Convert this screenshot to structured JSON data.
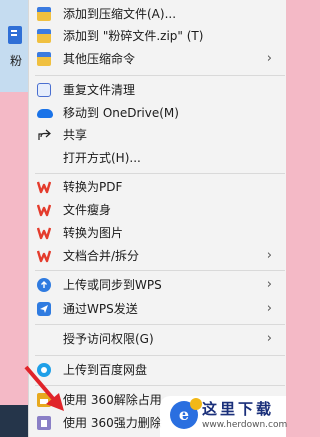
{
  "background": {
    "file_label": "粉"
  },
  "menu": {
    "items": [
      {
        "label": "添加到压缩文件(A)...",
        "icon": "archive-icon"
      },
      {
        "label": "添加到 \"粉碎文件.zip\" (T)",
        "icon": "archive-icon"
      },
      {
        "label": "其他压缩命令",
        "icon": "archive-icon",
        "submenu": true
      },
      {
        "label": "重复文件清理",
        "icon": "duplicate-cleanup-icon"
      },
      {
        "label": "移动到 OneDrive(M)",
        "icon": "onedrive-icon"
      },
      {
        "label": "共享",
        "icon": "share-icon"
      },
      {
        "label": "打开方式(H)...",
        "icon": ""
      },
      {
        "label": "转换为PDF",
        "icon": "wps-icon"
      },
      {
        "label": "文件瘦身",
        "icon": "wps-icon"
      },
      {
        "label": "转换为图片",
        "icon": "wps-icon"
      },
      {
        "label": "文档合并/拆分",
        "icon": "wps-icon",
        "submenu": true
      },
      {
        "label": "上传或同步到WPS",
        "icon": "cloud-upload-icon",
        "submenu": true
      },
      {
        "label": "通过WPS发送",
        "icon": "send-icon",
        "submenu": true
      },
      {
        "label": "授予访问权限(G)",
        "icon": "",
        "submenu": true
      },
      {
        "label": "上传到百度网盘",
        "icon": "baidu-netdisk-icon"
      },
      {
        "label": "使用 360解除占用",
        "icon": "360-unlock-icon"
      },
      {
        "label": "使用 360强力删除",
        "icon": "360-delete-icon"
      }
    ]
  },
  "watermark": {
    "logo_char": "e",
    "title": "这里下载",
    "url": "www.herdown.com"
  },
  "colors": {
    "menu_bg": "#f3f3f3",
    "desktop_bg": "#f4b9c6",
    "annotation_red": "#e0242a",
    "wps_red": "#e43b2c"
  }
}
